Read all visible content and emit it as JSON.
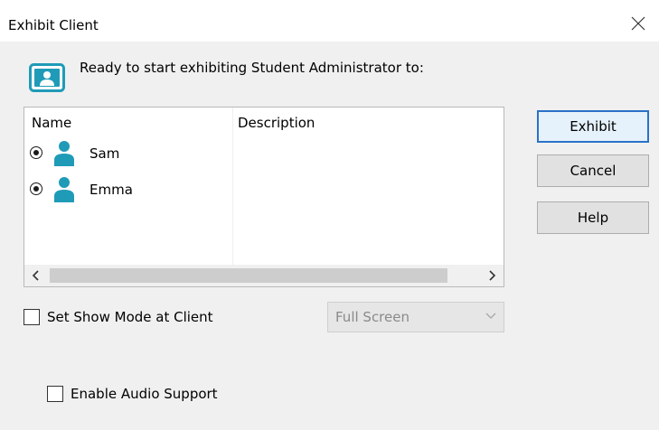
{
  "window": {
    "title": "Exhibit Client",
    "close_icon": "close-icon"
  },
  "header": {
    "icon": "presentation-person-icon",
    "text": "Ready to start exhibiting Student Administrator to:",
    "accent_color": "#1f9bb8"
  },
  "list": {
    "columns": [
      "Name",
      "Description"
    ],
    "rows": [
      {
        "name": "Sam",
        "description": "",
        "selected": true,
        "icon": "user-icon"
      },
      {
        "name": "Emma",
        "description": "",
        "selected": true,
        "icon": "user-icon"
      }
    ],
    "scroll_left_icon": "chevron-left-icon",
    "scroll_right_icon": "chevron-right-icon"
  },
  "buttons": {
    "exhibit": "Exhibit",
    "cancel": "Cancel",
    "help": "Help"
  },
  "options": {
    "show_mode_label": "Set Show Mode at Client",
    "show_mode_checked": false,
    "show_mode_dropdown_value": "Full Screen",
    "audio_label": "Enable Audio Support",
    "audio_checked": false
  }
}
